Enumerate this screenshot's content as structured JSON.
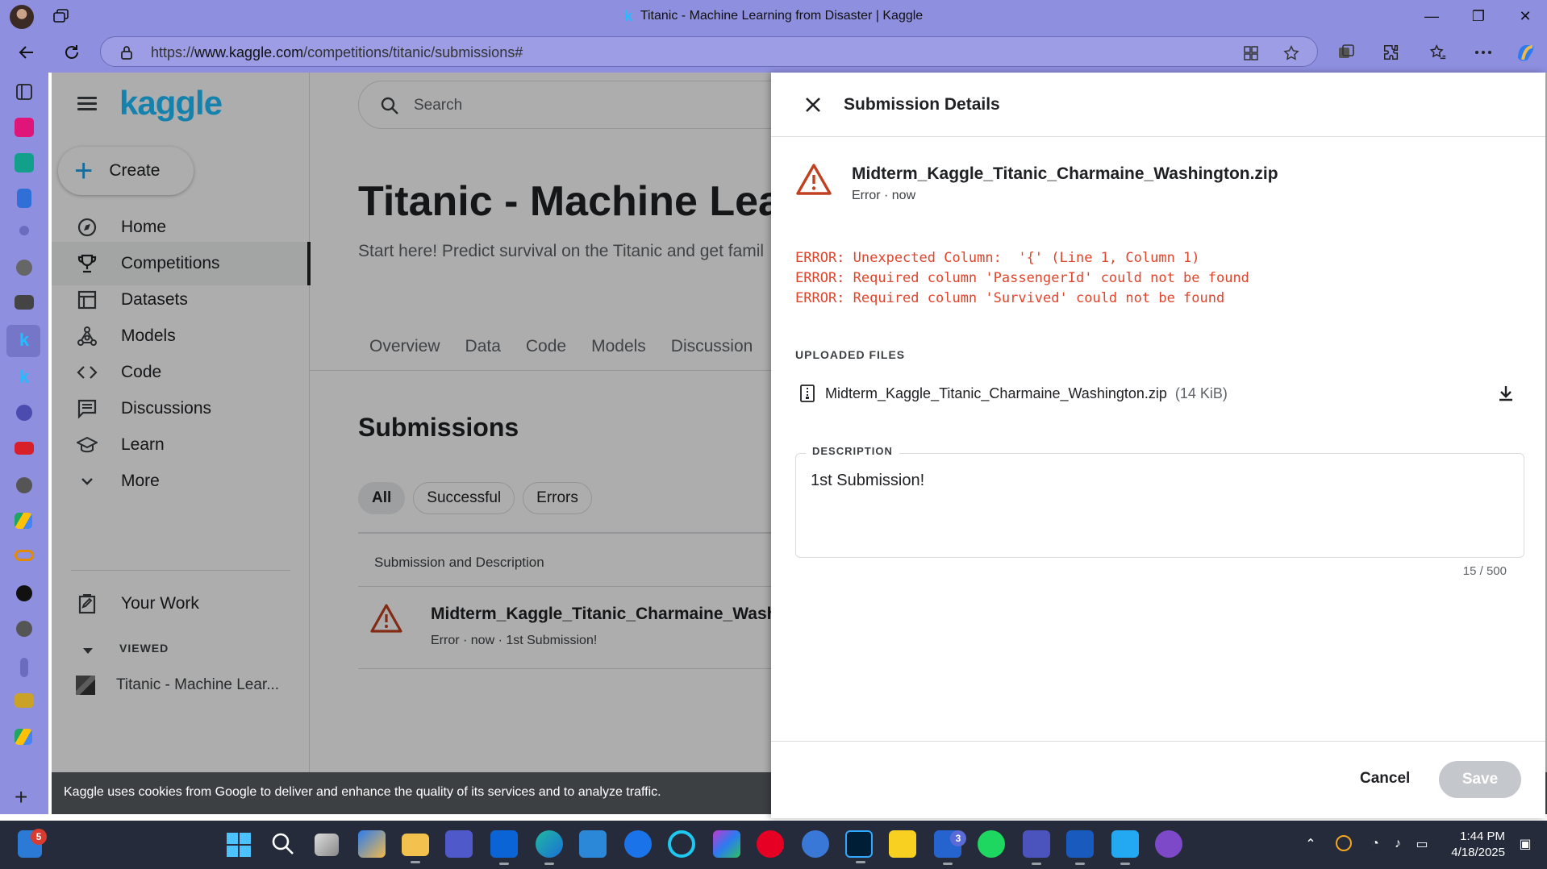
{
  "browser": {
    "window_title": "Titanic - Machine Learning from Disaster | Kaggle",
    "url_prefix": "https://",
    "url_host": "www.kaggle.com",
    "url_path": "/competitions/titanic/submissions#",
    "window_controls": [
      "minimize",
      "restore",
      "close"
    ],
    "accent_color": "#8f8fe0"
  },
  "kaggle": {
    "logo": "kaggle",
    "create_label": "Create",
    "nav": [
      {
        "label": "Home",
        "icon": "compass-icon"
      },
      {
        "label": "Competitions",
        "icon": "trophy-icon",
        "active": true
      },
      {
        "label": "Datasets",
        "icon": "table-icon"
      },
      {
        "label": "Models",
        "icon": "models-icon"
      },
      {
        "label": "Code",
        "icon": "code-icon"
      },
      {
        "label": "Discussions",
        "icon": "discussion-icon"
      },
      {
        "label": "Learn",
        "icon": "school-icon"
      },
      {
        "label": "More",
        "icon": "chevron-down-icon"
      }
    ],
    "your_work": "Your Work",
    "viewed_label": "VIEWED",
    "viewed_item": "Titanic - Machine Lear...",
    "search_placeholder": "Search",
    "competition_title": "Titanic - Machine Learn",
    "competition_subtitle": "Start here! Predict survival on the Titanic and get famil",
    "tabs": [
      "Overview",
      "Data",
      "Code",
      "Models",
      "Discussion"
    ],
    "submissions_heading": "Submissions",
    "filters": [
      "All",
      "Successful",
      "Errors"
    ],
    "table_header": "Submission and Description",
    "row": {
      "name": "Midterm_Kaggle_Titanic_Charmaine_Washin",
      "meta": "Error · now · 1st Submission!"
    },
    "cookie_notice": "Kaggle uses cookies from Google to deliver and enhance the quality of its services and to analyze traffic."
  },
  "panel": {
    "title": "Submission Details",
    "file_name": "Midterm_Kaggle_Titanic_Charmaine_Washington.zip",
    "status": "Error · now",
    "errors": [
      "ERROR: Unexpected Column:  '{' (Line 1, Column 1)",
      "ERROR: Required column 'PassengerId' could not be found",
      "ERROR: Required column 'Survived' could not be found"
    ],
    "uploaded_files_label": "UPLOADED FILES",
    "uploaded_file": "Midterm_Kaggle_Titanic_Charmaine_Washington.zip",
    "uploaded_size": "(14 KiB)",
    "description_label": "DESCRIPTION",
    "description_value": "1st Submission!",
    "char_count": "15 / 500",
    "cancel_label": "Cancel",
    "save_label": "Save",
    "error_color": "#e0452c"
  },
  "taskbar": {
    "time": "1:44 PM",
    "date": "4/18/2025",
    "mail_badge": "5",
    "todo_badge": "3"
  }
}
